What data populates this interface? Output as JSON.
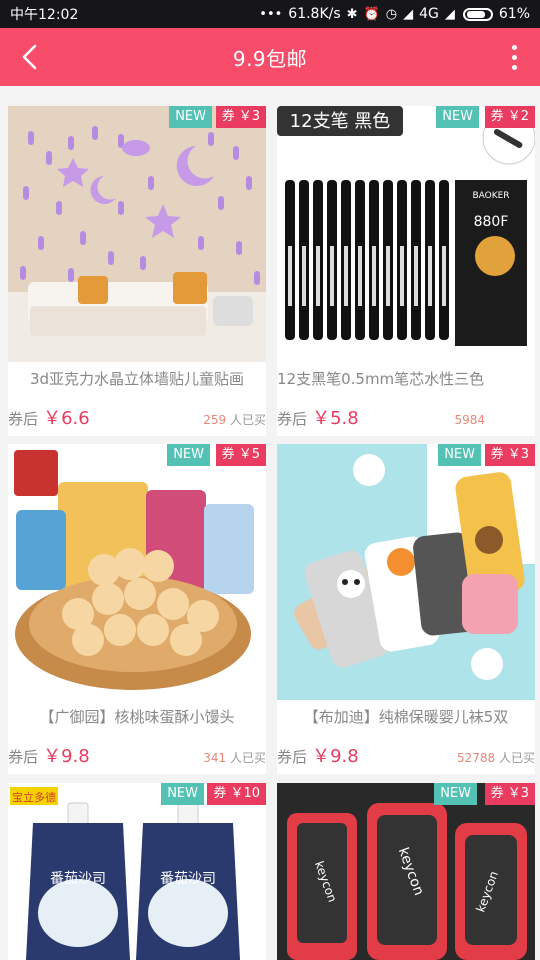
{
  "status_bar": {
    "time": "中午12:02",
    "network_speed": "61.8K/s",
    "network_type": "4G",
    "battery": "61%",
    "icons": [
      "dots-icon",
      "bluetooth-icon",
      "alarm-icon",
      "clock-icon",
      "signal-icon",
      "wifi-icon",
      "battery-icon"
    ]
  },
  "app_bar": {
    "title": "9.9包邮",
    "back_icon": "chevron-left-icon",
    "menu_icon": "more-vertical-icon",
    "color": "#f74d6a"
  },
  "labels": {
    "new_tag": "NEW",
    "after_coupon": "券后",
    "bought_suffix": "人已买"
  },
  "products": [
    {
      "name": "3d亚克力水晶立体墙贴儿童贴画",
      "coupon": "券 ￥3",
      "price": "￥6.6",
      "sold": "259",
      "image_banner": ""
    },
    {
      "name": "12支黑笔0.5mm笔芯水性三色",
      "coupon": "券 ￥2",
      "price": "￥5.8",
      "sold": "5984",
      "image_banner": "12支笔 黑色",
      "image_box_text": "880F",
      "image_box_brand": "BAOKER"
    },
    {
      "name": "【广御园】核桃味蛋酥小馒头",
      "coupon": "券 ￥5",
      "price": "￥9.8",
      "sold": "341",
      "image_banner": ""
    },
    {
      "name": "【布加迪】纯棉保暖婴儿袜5双",
      "coupon": "券 ￥3",
      "price": "￥9.8",
      "sold": "52788",
      "image_banner": ""
    },
    {
      "name": "",
      "coupon": "券 ￥10",
      "price": "",
      "sold": "",
      "image_banner": "宝立多德",
      "image_pouch_text": "番茄沙司"
    },
    {
      "name": "",
      "coupon": "券 ￥3",
      "price": "",
      "sold": "",
      "image_banner": "",
      "image_brand": "keycon"
    }
  ],
  "colors": {
    "accent": "#f74d6a",
    "new_tag": "#53c2b4",
    "coupon_tag": "#ea3c60",
    "price": "#ea3c60"
  }
}
